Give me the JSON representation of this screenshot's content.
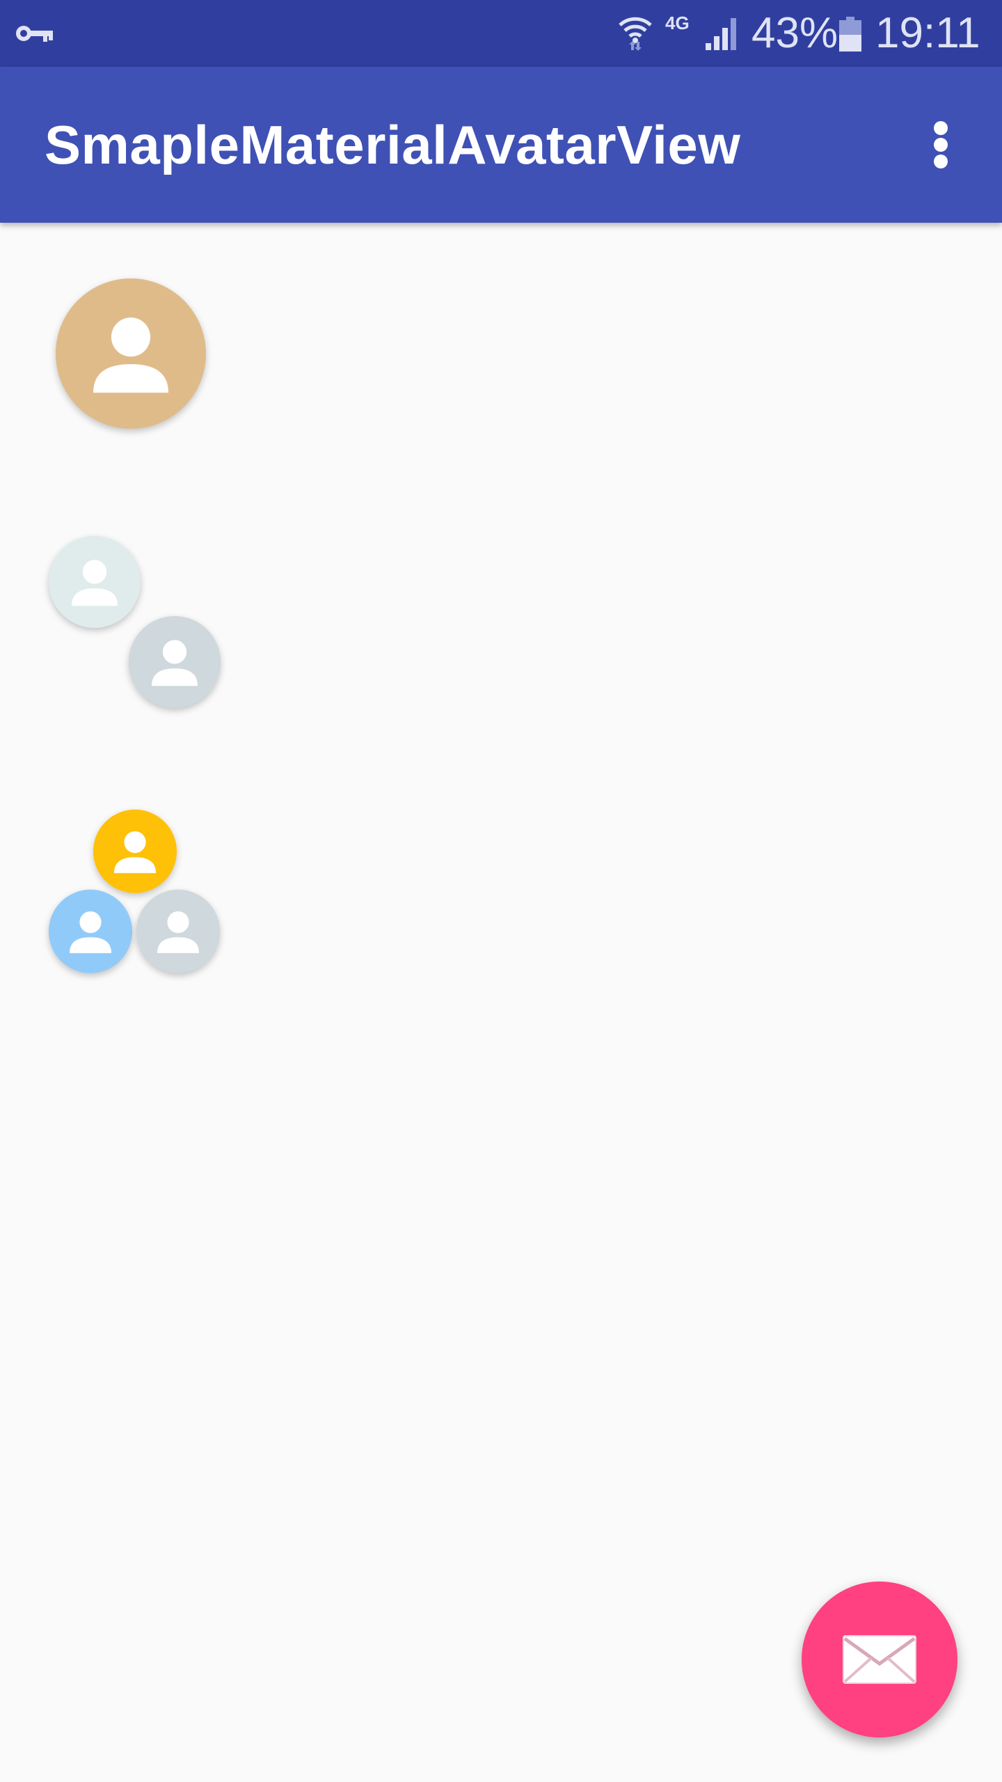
{
  "status_bar": {
    "network": "4G",
    "battery_percent": "43%",
    "time": "19:11",
    "icons": [
      "vpn-key-icon",
      "wifi-icon",
      "cell-signal-icon",
      "battery-icon"
    ]
  },
  "app_bar": {
    "title": "SmapleMaterialAvatarView",
    "menu_icon": "overflow-menu-icon"
  },
  "avatars": {
    "icon": "person-icon",
    "groups": [
      {
        "name": "single",
        "colors": [
          "#e0bb8a"
        ]
      },
      {
        "name": "pair",
        "colors": [
          "#e0ecec",
          "#cfd8dc"
        ]
      },
      {
        "name": "trio",
        "colors": [
          "#ffc107",
          "#90caf9",
          "#cfd8dc"
        ]
      }
    ]
  },
  "fab": {
    "icon": "email-icon",
    "color": "#ff4081"
  },
  "colors": {
    "status_bar": "#303f9f",
    "app_bar": "#3f51b5",
    "background": "#fafafa"
  }
}
